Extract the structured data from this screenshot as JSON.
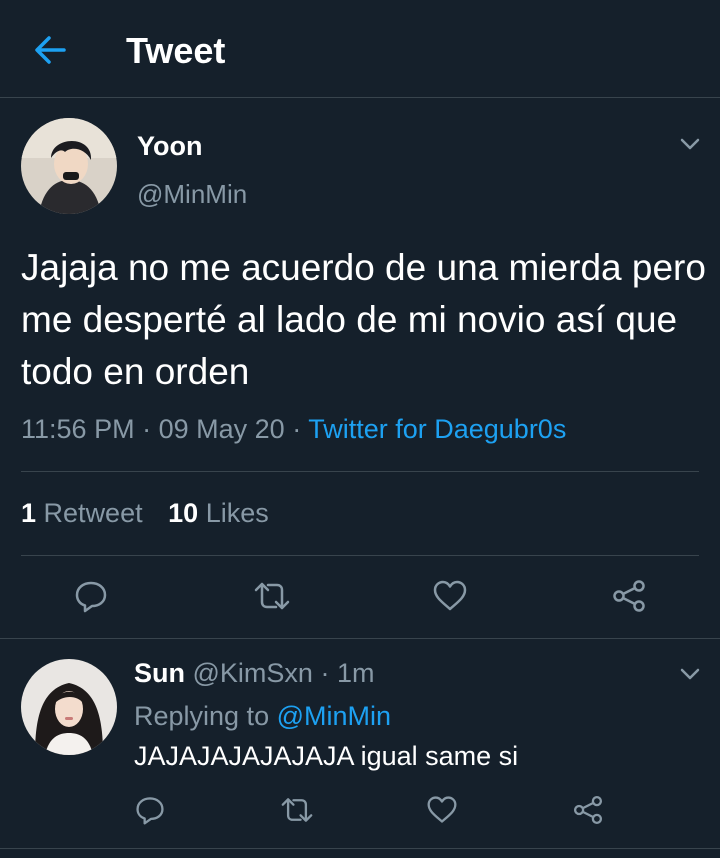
{
  "header": {
    "title": "Tweet",
    "back_icon": "arrow-left-icon",
    "accent": "#1da1f2"
  },
  "tweet": {
    "author_name": "Yoon",
    "author_handle": "@MinMin",
    "text": "Jajaja no me acuerdo de una mierda pero me desperté al lado de mi novio así que todo en orden",
    "time": "11:56 PM",
    "date": "09 May 20",
    "separator": "·",
    "source": "Twitter for Daegubr0s",
    "retweet_count": "1",
    "retweet_label": "Retweet",
    "like_count": "10",
    "like_label": "Likes"
  },
  "reply": {
    "name": "Sun",
    "handle": "@KimSxn",
    "separator": "·",
    "time": "1m",
    "replying_label": "Replying to",
    "replying_to": "@MinMin",
    "text": "JAJAJAJAJAJAJA igual same si"
  },
  "icons": [
    "reply-icon",
    "retweet-icon",
    "like-icon",
    "share-icon",
    "chevron-down-icon"
  ],
  "colors": {
    "background": "#15202b",
    "muted": "#8899a6",
    "divider": "#38444d",
    "link": "#1da1f2"
  }
}
